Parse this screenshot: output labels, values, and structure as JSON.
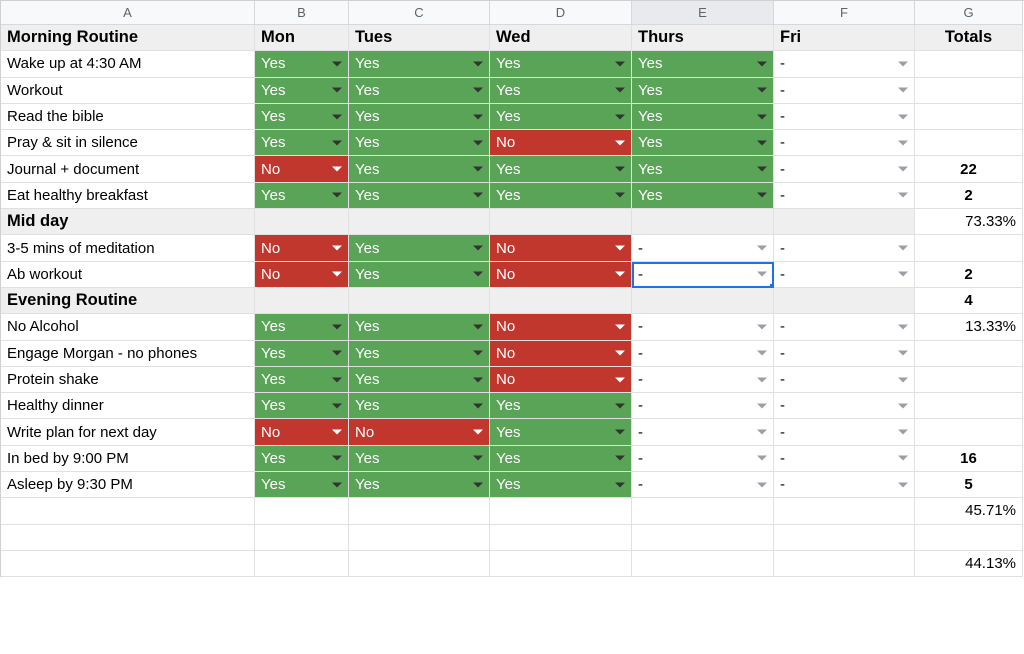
{
  "columns": [
    "A",
    "B",
    "C",
    "D",
    "E",
    "F",
    "G"
  ],
  "active_column_index": 4,
  "headers": {
    "morning": "Morning Routine",
    "mon": "Mon",
    "tues": "Tues",
    "wed": "Wed",
    "thurs": "Thurs",
    "fri": "Fri",
    "totals": "Totals",
    "mid": "Mid day",
    "evening": "Evening Routine"
  },
  "tasks": {
    "wake": {
      "label": "Wake up at 4:30 AM",
      "mon": "Yes",
      "tue": "Yes",
      "wed": "Yes",
      "thu": "Yes",
      "fri": "-",
      "total": ""
    },
    "workout": {
      "label": "Workout",
      "mon": "Yes",
      "tue": "Yes",
      "wed": "Yes",
      "thu": "Yes",
      "fri": "-",
      "total": ""
    },
    "bible": {
      "label": "Read the bible",
      "mon": "Yes",
      "tue": "Yes",
      "wed": "Yes",
      "thu": "Yes",
      "fri": "-",
      "total": ""
    },
    "pray": {
      "label": "Pray & sit in silence",
      "mon": "Yes",
      "tue": "Yes",
      "wed": "No",
      "thu": "Yes",
      "fri": "-",
      "total": ""
    },
    "journal": {
      "label": "Journal + document",
      "mon": "No",
      "tue": "Yes",
      "wed": "Yes",
      "thu": "Yes",
      "fri": "-",
      "total": "22"
    },
    "breakfast": {
      "label": "Eat healthy breakfast",
      "mon": "Yes",
      "tue": "Yes",
      "wed": "Yes",
      "thu": "Yes",
      "fri": "-",
      "total": "2"
    },
    "meditate": {
      "label": "3-5 mins of meditation",
      "mon": "No",
      "tue": "Yes",
      "wed": "No",
      "thu": "-",
      "fri": "-",
      "total": ""
    },
    "ab": {
      "label": "Ab workout",
      "mon": "No",
      "tue": "Yes",
      "wed": "No",
      "thu": "-",
      "fri": "-",
      "total": "2"
    },
    "alcohol": {
      "label": "No Alcohol",
      "mon": "Yes",
      "tue": "Yes",
      "wed": "No",
      "thu": "-",
      "fri": "-",
      "total": "13.33%"
    },
    "morgan": {
      "label": "Engage Morgan - no phones",
      "mon": "Yes",
      "tue": "Yes",
      "wed": "No",
      "thu": "-",
      "fri": "-",
      "total": ""
    },
    "protein": {
      "label": "Protein shake",
      "mon": "Yes",
      "tue": "Yes",
      "wed": "No",
      "thu": "-",
      "fri": "-",
      "total": ""
    },
    "dinner": {
      "label": "Healthy dinner",
      "mon": "Yes",
      "tue": "Yes",
      "wed": "Yes",
      "thu": "-",
      "fri": "-",
      "total": ""
    },
    "plan": {
      "label": "Write plan for next day",
      "mon": "No",
      "tue": "No",
      "wed": "Yes",
      "thu": "-",
      "fri": "-",
      "total": ""
    },
    "bed": {
      "label": "In bed by 9:00 PM",
      "mon": "Yes",
      "tue": "Yes",
      "wed": "Yes",
      "thu": "-",
      "fri": "-",
      "total": "16"
    },
    "asleep": {
      "label": "Asleep by 9:30 PM",
      "mon": "Yes",
      "tue": "Yes",
      "wed": "Yes",
      "thu": "-",
      "fri": "-",
      "total": "5"
    }
  },
  "totals": {
    "mid_pct": "73.33%",
    "evening_count": "4",
    "after_asleep_pct": "45.71%",
    "grand_pct": "44.13%"
  },
  "selected_cell": "E11",
  "chart_data": {
    "type": "table",
    "columns": [
      "Task",
      "Mon",
      "Tues",
      "Wed",
      "Thurs",
      "Fri",
      "Totals"
    ],
    "sections": [
      {
        "name": "Morning Routine",
        "rows": [
          [
            "Wake up at 4:30 AM",
            "Yes",
            "Yes",
            "Yes",
            "Yes",
            "-",
            ""
          ],
          [
            "Workout",
            "Yes",
            "Yes",
            "Yes",
            "Yes",
            "-",
            ""
          ],
          [
            "Read the bible",
            "Yes",
            "Yes",
            "Yes",
            "Yes",
            "-",
            ""
          ],
          [
            "Pray & sit in silence",
            "Yes",
            "Yes",
            "No",
            "Yes",
            "-",
            ""
          ],
          [
            "Journal + document",
            "No",
            "Yes",
            "Yes",
            "Yes",
            "-",
            "22"
          ],
          [
            "Eat healthy breakfast",
            "Yes",
            "Yes",
            "Yes",
            "Yes",
            "-",
            "2"
          ]
        ],
        "section_total": "73.33%"
      },
      {
        "name": "Mid day",
        "rows": [
          [
            "3-5 mins of meditation",
            "No",
            "Yes",
            "No",
            "-",
            "-",
            ""
          ],
          [
            "Ab workout",
            "No",
            "Yes",
            "No",
            "-",
            "-",
            "2"
          ]
        ],
        "section_total": "4"
      },
      {
        "name": "Evening Routine",
        "rows": [
          [
            "No Alcohol",
            "Yes",
            "Yes",
            "No",
            "-",
            "-",
            "13.33%"
          ],
          [
            "Engage Morgan - no phones",
            "Yes",
            "Yes",
            "No",
            "-",
            "-",
            ""
          ],
          [
            "Protein shake",
            "Yes",
            "Yes",
            "No",
            "-",
            "-",
            ""
          ],
          [
            "Healthy dinner",
            "Yes",
            "Yes",
            "Yes",
            "-",
            "-",
            ""
          ],
          [
            "Write plan for next day",
            "No",
            "No",
            "Yes",
            "-",
            "-",
            ""
          ],
          [
            "In bed by 9:00 PM",
            "Yes",
            "Yes",
            "Yes",
            "-",
            "-",
            "16"
          ],
          [
            "Asleep by 9:30 PM",
            "Yes",
            "Yes",
            "Yes",
            "-",
            "-",
            "5"
          ]
        ],
        "section_total": "45.71%"
      }
    ],
    "grand_total": "44.13%"
  }
}
